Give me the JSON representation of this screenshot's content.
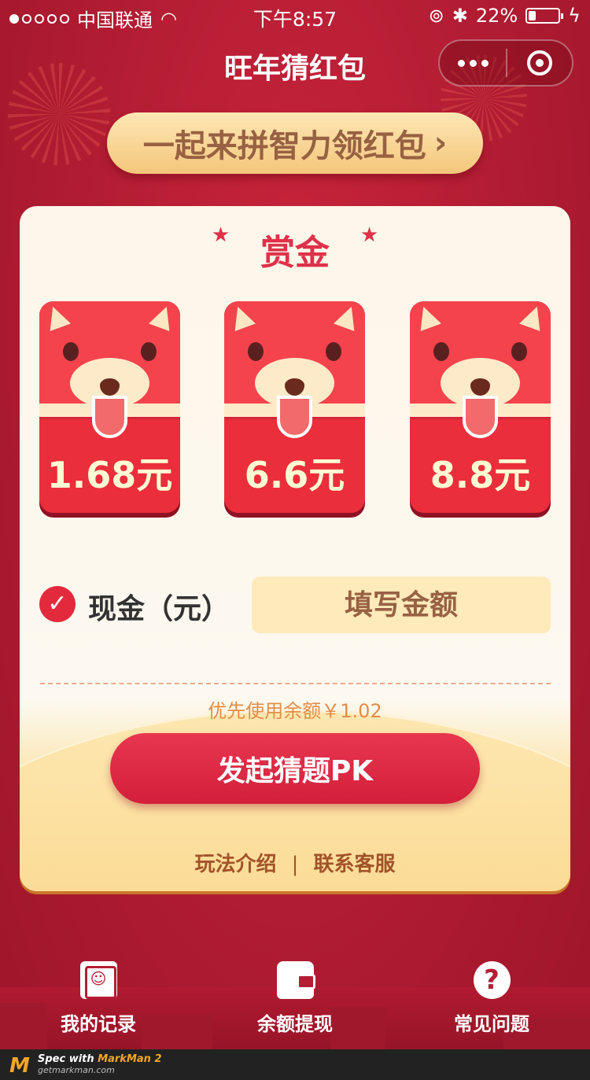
{
  "status_bar": {
    "carrier": "中国联通",
    "time": "下午8:57",
    "battery": "22%",
    "battery_level": 0.22
  },
  "nav": {
    "title": "旺年猜红包"
  },
  "banner": {
    "text": "一起来拼智力领红包",
    "chevron": "›"
  },
  "card": {
    "title": "赏金",
    "star": "★",
    "packets": [
      {
        "amount": "1.68元"
      },
      {
        "amount": "6.6元"
      },
      {
        "amount": "8.8元"
      }
    ],
    "cash_label": "现金（元）",
    "check": "✓",
    "input_placeholder": "填写金额",
    "balance_note": "优先使用余额￥1.02",
    "pk_button": "发起猜题PK",
    "links": {
      "rules": "玩法介绍",
      "separator": "|",
      "contact": "联系客服"
    }
  },
  "bottom_nav": [
    {
      "label": "我的记录",
      "icon": "record-book-icon"
    },
    {
      "label": "余额提现",
      "icon": "wallet-icon"
    },
    {
      "label": "常见问题",
      "icon": "help-icon"
    }
  ],
  "footer": {
    "logo": "M",
    "line1_prefix": "Spec with ",
    "line1_brand": "MarkMan 2",
    "line2": "getmarkman.com"
  },
  "colors": {
    "background": "#b51d33",
    "banner_text": "#986143",
    "title": "#df3149",
    "packet_amount": "#fefcd2",
    "input_bg": "#ffeabb",
    "balance": "#e48d48",
    "links": "#a25329",
    "cash_label": "#323232"
  }
}
